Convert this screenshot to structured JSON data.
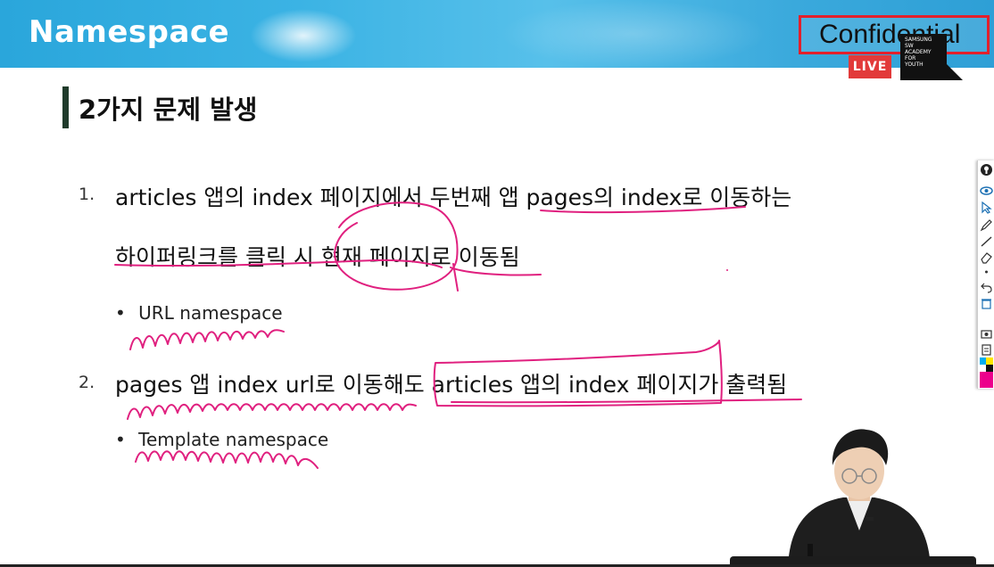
{
  "header": {
    "title": "Namespace",
    "confidential": "Confidential",
    "live_badge": "LIVE",
    "logo_text": [
      "SAMSUNG",
      "SW",
      "ACADEMY",
      "FOR",
      "YOUTH"
    ]
  },
  "section": {
    "title": "2가지 문제 발생"
  },
  "items": [
    {
      "number": "1.",
      "lines": [
        "articles 앱의 index 페이지에서 두번째 앱 pages의 index로 이동하는",
        "하이퍼링크를 클릭 시 현재 페이지로 이동됨"
      ],
      "bullet": "URL namespace"
    },
    {
      "number": "2.",
      "lines": [
        "pages 앱 index url로 이동해도 articles 앱의 index 페이지가 출력됨"
      ],
      "bullet": "Template namespace"
    }
  ],
  "bullet_char": "•",
  "colors": {
    "header": "#3bb3e4",
    "confidential_border": "#e2202c",
    "live": "#e23a3a",
    "annotation": "#e0207f",
    "section_bar": "#1f3b2b"
  },
  "toolbar_icons": [
    "info-icon",
    "eye-icon",
    "cursor-icon",
    "pen-icon",
    "line-icon",
    "eraser-icon",
    "dot-icon",
    "undo-icon",
    "trash-icon",
    "camera-icon",
    "clipboard-icon",
    "color-palette-icon"
  ]
}
